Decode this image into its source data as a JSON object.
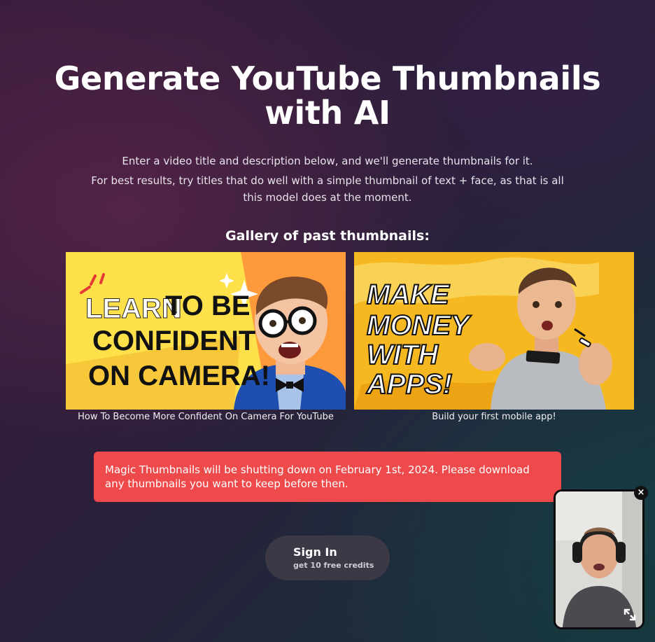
{
  "hero": {
    "title_line1": "Generate YouTube Thumbnails",
    "title_line2": "with AI",
    "intro_line1": "Enter a video title and description below, and we'll generate thumbnails for it.",
    "intro_line2": "For best results, try titles that do well with a simple thumbnail of text + face, as that is all this model does at the moment."
  },
  "gallery": {
    "heading": "Gallery of past thumbnails:",
    "items": [
      {
        "thumb_text": [
          "LEARN TO BE",
          "CONFIDENT",
          "ON CAMERA!"
        ],
        "caption": "How To Become More Confident On Camera For YouTube"
      },
      {
        "thumb_text": [
          "MAKE",
          "MONEY",
          "WITH",
          "APPS!"
        ],
        "caption": "Build your first mobile app!"
      }
    ]
  },
  "banner": {
    "message": "Magic Thumbnails will be shutting down on February 1st, 2024. Please download any thumbnails you want to keep before then."
  },
  "signin": {
    "label": "Sign In",
    "sublabel": "get 10 free credits"
  },
  "video_overlay": {
    "close_glyph": "×",
    "icons": [
      "close-icon",
      "expand-icon"
    ]
  },
  "colors": {
    "banner": "#ee4a4c",
    "signin_bg": "#3c3947",
    "thumb1_yellow": "#fde04a",
    "thumb1_orange": "#ff9a3c",
    "thumb2_yellow": "#f6b820"
  }
}
